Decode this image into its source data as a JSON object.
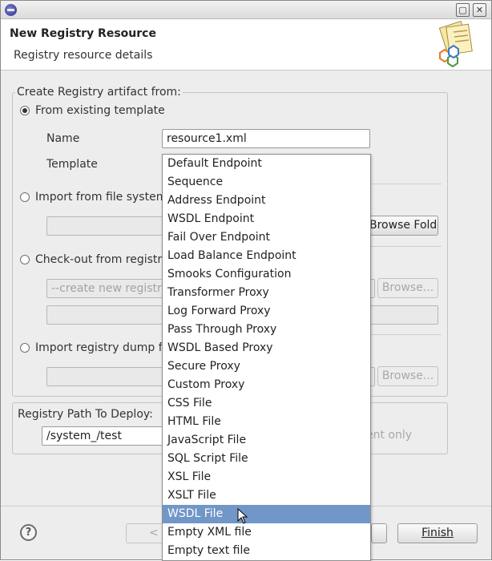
{
  "window": {
    "app_icon": "eclipse-icon",
    "restore_icon": "restore-icon",
    "close_icon": "close-icon"
  },
  "header": {
    "title": "New Registry Resource",
    "subtitle": "Registry resource details",
    "art_icon": "registry-wizard-banner-icon"
  },
  "create_group": {
    "legend": "Create Registry artifact from:",
    "option_template": "From existing template",
    "name_label": "Name",
    "name_value": "resource1.xml",
    "template_label": "Template",
    "option_import_file": "Import from file system",
    "browse_folder_label": "Browse Folde",
    "option_checkout": "Check-out from registry",
    "checkout_placeholder": "--create new registry",
    "checkout_browse": "Browse...",
    "option_dump": "Import registry dump fi",
    "dump_browse": "Browse..."
  },
  "deploy_group": {
    "legend": "Registry Path To Deploy:",
    "path_value": "/system_/test",
    "option_hint": "ent only"
  },
  "footer": {
    "help_icon": "help-icon",
    "back_label": "< B",
    "finish_label": "Finish"
  },
  "template_dropdown": {
    "items": [
      "Default Endpoint",
      "Sequence",
      "Address Endpoint",
      "WSDL Endpoint",
      "Fail Over Endpoint",
      "Load Balance Endpoint",
      "Smooks Configuration",
      "Transformer Proxy",
      "Log Forward Proxy",
      "Pass Through Proxy",
      "WSDL Based Proxy",
      "Secure Proxy",
      "Custom Proxy",
      "CSS File",
      "HTML File",
      "JavaScript File",
      "SQL Script File",
      "XSL File",
      "XSLT File",
      "WSDL File",
      "Empty XML file",
      "Empty text file"
    ],
    "selected": "WSDL File",
    "selected_color": "#7196c8"
  },
  "colors": {
    "window_bg": "#ededed",
    "header_bg": "#ffffff"
  }
}
